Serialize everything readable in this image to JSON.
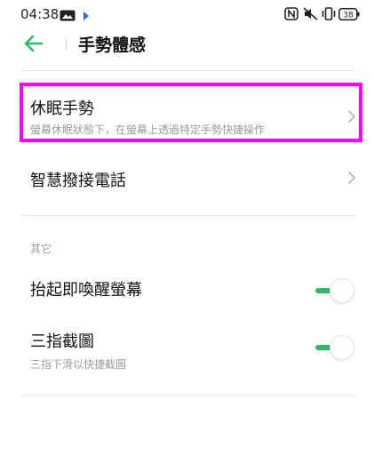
{
  "status_bar": {
    "time": "04:38",
    "battery": "38",
    "icons": [
      "image-icon",
      "play-icon",
      "nfc-icon",
      "mute-icon",
      "vibrate-icon",
      "battery-icon"
    ]
  },
  "header": {
    "title": "手勢體感",
    "back_icon": "back-arrow-icon"
  },
  "items": [
    {
      "title": "休眠手勢",
      "subtitle": "螢幕休眠狀態下，在螢幕上透過特定手勢快捷操作"
    },
    {
      "title": "智慧撥接電話"
    }
  ],
  "section": {
    "label": "其它",
    "items": [
      {
        "title": "抬起即喚醒螢幕",
        "enabled": true
      },
      {
        "title": "三指截圖",
        "subtitle": "三指下滑以快捷截圖",
        "enabled": true
      }
    ]
  },
  "colors": {
    "accent": "#2fb86b",
    "highlight": "#ff00ff"
  }
}
